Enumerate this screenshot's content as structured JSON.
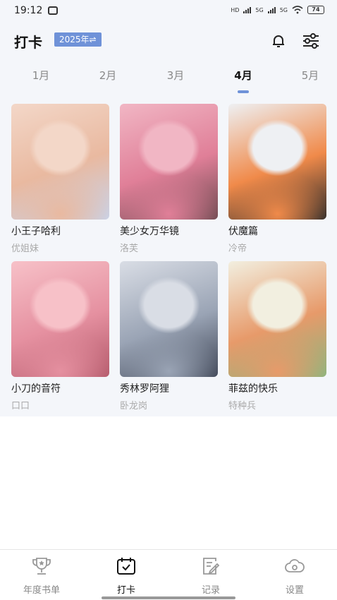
{
  "status": {
    "time": "19:12",
    "net1": "HD",
    "net2": "5G",
    "net3": "5G",
    "battery": "74"
  },
  "header": {
    "title": "打卡",
    "year_badge": "2025年⇌"
  },
  "months": [
    "1月",
    "2月",
    "3月",
    "4月",
    "5月"
  ],
  "active_month": "4月",
  "books": [
    {
      "title": "小王子哈利",
      "author": "优姐妹",
      "palette": [
        "#f3d7c8",
        "#e9b9a0",
        "#c8d3ea"
      ]
    },
    {
      "title": "美少女万华镜",
      "author": "洛芙",
      "palette": [
        "#f1b6c4",
        "#e07f98",
        "#6d4a50"
      ]
    },
    {
      "title": "伏魔篇",
      "author": "冷帝",
      "palette": [
        "#eef0f3",
        "#f08a4a",
        "#2b2b2b"
      ]
    },
    {
      "title": "小刀的音符",
      "author": "口口",
      "palette": [
        "#f7c1c8",
        "#e590a0",
        "#b3596a"
      ]
    },
    {
      "title": "秀林罗阿狸",
      "author": "卧龙岗",
      "palette": [
        "#d9dde5",
        "#9aa4b5",
        "#3f4656"
      ]
    },
    {
      "title": "菲兹的快乐",
      "author": "特种兵",
      "palette": [
        "#f2efe0",
        "#e79a6a",
        "#8bb67e"
      ]
    }
  ],
  "nav": [
    {
      "label": "年度书单",
      "icon": "trophy-icon"
    },
    {
      "label": "打卡",
      "icon": "checkin-calendar-icon"
    },
    {
      "label": "记录",
      "icon": "notes-edit-icon"
    },
    {
      "label": "设置",
      "icon": "settings-cloud-icon"
    }
  ],
  "colors": {
    "accent": "#6f92d8",
    "background": "#f4f6fa",
    "muted_text": "#aaaaaa"
  }
}
